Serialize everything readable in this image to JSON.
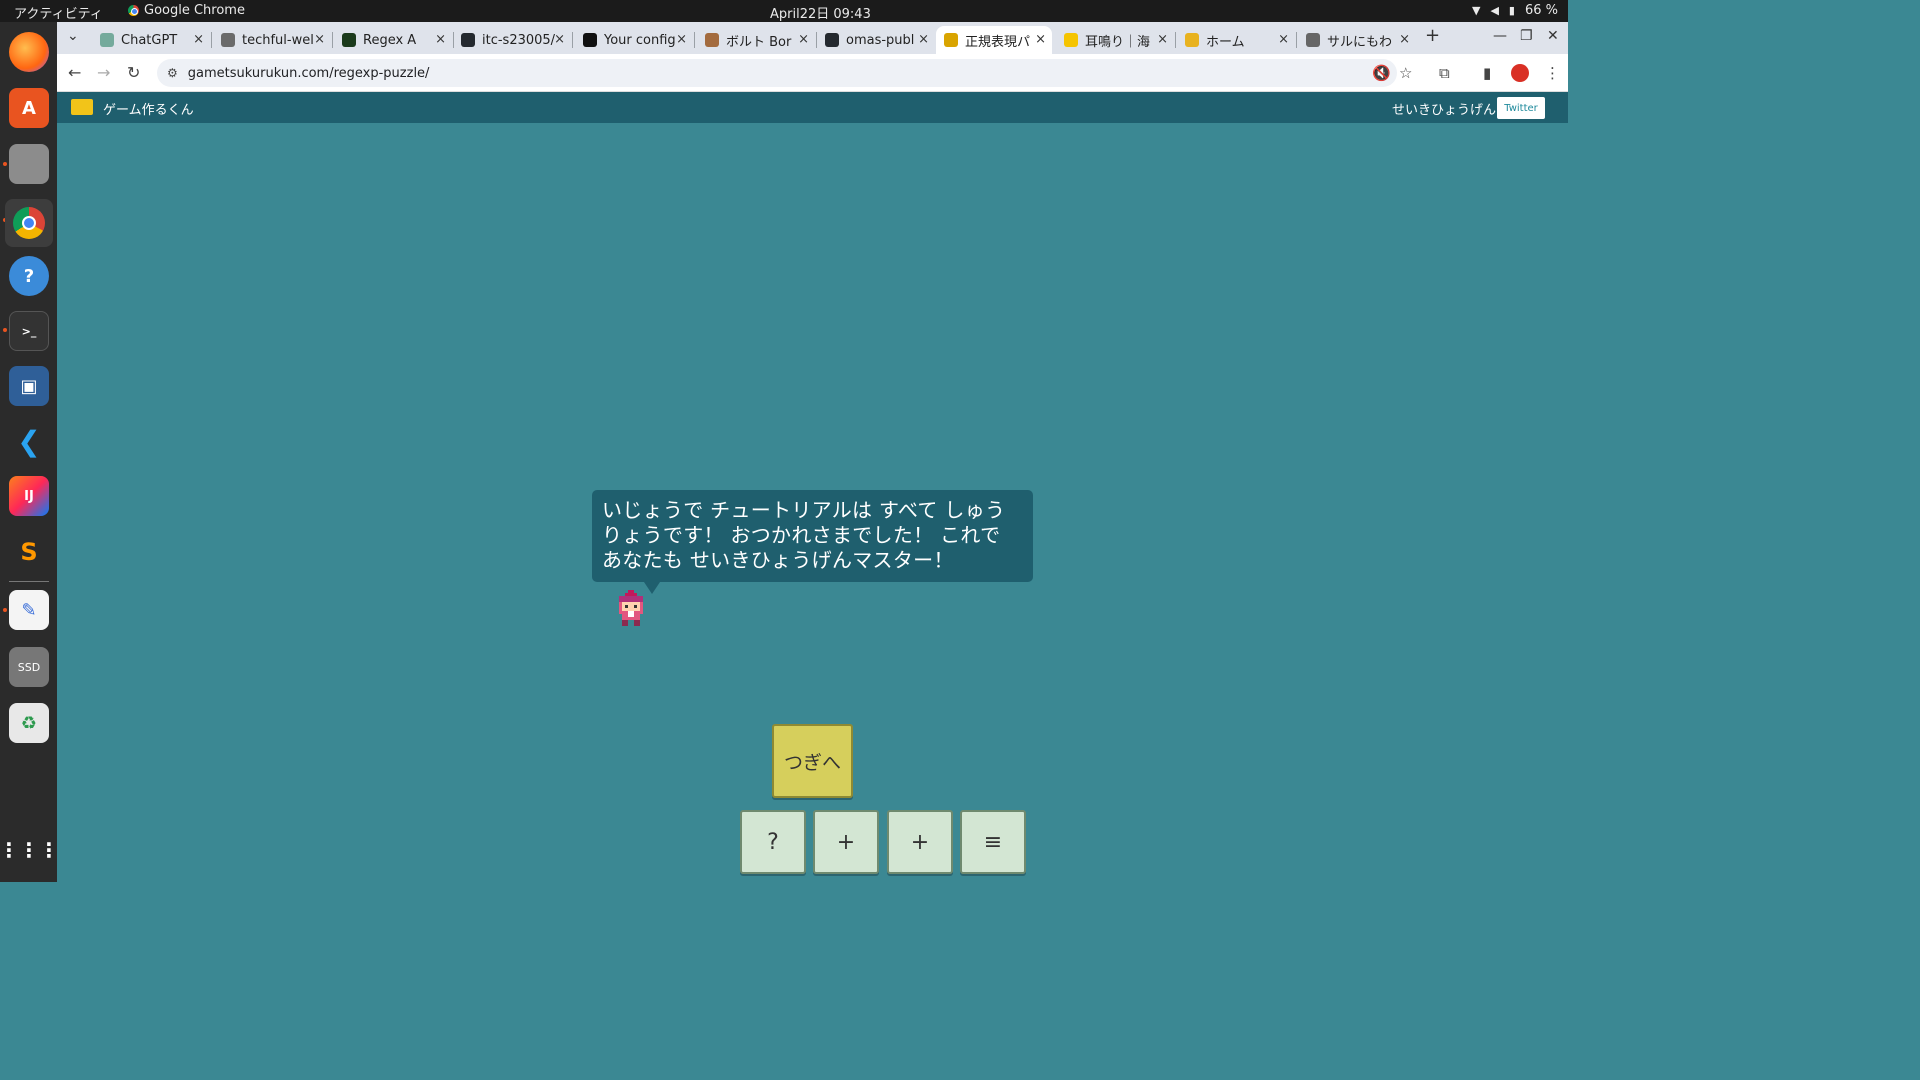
{
  "topbar": {
    "activities": "アクティビティ",
    "app_name": "Google Chrome",
    "clock": "April22日 09:43",
    "battery": "66 %"
  },
  "dock": {
    "items": [
      "firefox-icon",
      "app-center-icon",
      "files-icon",
      "chrome-icon",
      "help-icon",
      "terminal-icon",
      "virtualbox-icon",
      "vscode-icon",
      "intellij-icon",
      "sublime-icon",
      "text-editor-icon",
      "ssd-drive-icon",
      "trash-icon",
      "app-grid-icon"
    ],
    "ssd_label": "SSD"
  },
  "tabs": [
    {
      "label": "ChatGPT",
      "close": "×"
    },
    {
      "label": "techful-wel",
      "close": "×"
    },
    {
      "label": "Regex A",
      "close": "×"
    },
    {
      "label": "itc-s23005/",
      "close": "×"
    },
    {
      "label": "Your config",
      "close": "×"
    },
    {
      "label": "ボルト Bor",
      "close": "×"
    },
    {
      "label": "omas-publ",
      "close": "×"
    },
    {
      "label": "正規表現パ",
      "close": "×"
    },
    {
      "label": "耳鳴り｜海",
      "close": "×"
    },
    {
      "label": "ホーム",
      "close": "×"
    },
    {
      "label": "サルにもわ",
      "close": "×"
    }
  ],
  "tabs_new": "+",
  "toolbar": {
    "url": "gametsukurukun.com/regexp-puzzle/"
  },
  "page_header": {
    "site_name": "ゲーム作るくん",
    "nav_link": "せいきひょうげん",
    "twitter": "Twitter"
  },
  "game": {
    "message": "いじょうで チュートリアルは すべて しゅうりょうです！ おつかれさまでした！ これで あなたも せいきひょうげんマスター！",
    "next_button": "つぎへ",
    "controls": [
      "?",
      "+",
      "+",
      "≡"
    ]
  }
}
